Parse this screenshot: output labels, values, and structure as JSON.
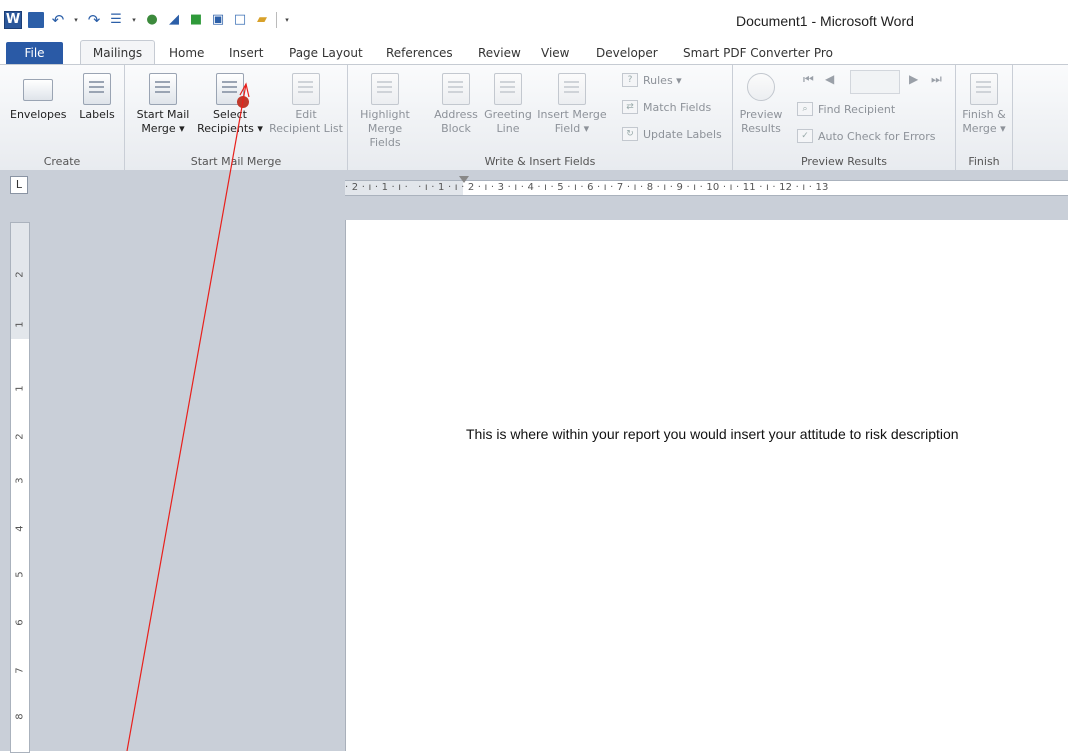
{
  "window": {
    "title": "Document1 - Microsoft Word"
  },
  "quick_access": {
    "logo_letter": "W",
    "icons": [
      "word-logo-icon",
      "save-icon",
      "undo-icon",
      "redo-icon",
      "bullets-icon",
      "people-icon",
      "send-icon",
      "book-icon",
      "print-preview-icon",
      "new-document-icon",
      "open-folder-icon",
      "customize-icon"
    ]
  },
  "tabs": [
    {
      "id": "file",
      "label": "File"
    },
    {
      "id": "mailings",
      "label": "Mailings",
      "active": true
    },
    {
      "id": "home",
      "label": "Home"
    },
    {
      "id": "insert",
      "label": "Insert"
    },
    {
      "id": "page-layout",
      "label": "Page Layout"
    },
    {
      "id": "references",
      "label": "References"
    },
    {
      "id": "review",
      "label": "Review"
    },
    {
      "id": "view",
      "label": "View"
    },
    {
      "id": "developer",
      "label": "Developer"
    },
    {
      "id": "smart-pdf",
      "label": "Smart PDF Converter Pro"
    }
  ],
  "ribbon": {
    "create": {
      "title": "Create",
      "envelopes": "Envelopes",
      "labels": "Labels"
    },
    "start_mail_merge": {
      "title": "Start Mail Merge",
      "start_l1": "Start Mail",
      "start_l2": "Merge ▾",
      "select_l1": "Select",
      "select_l2": "Recipients ▾",
      "edit_l1": "Edit",
      "edit_l2": "Recipient List"
    },
    "write_insert": {
      "title": "Write & Insert Fields",
      "highlight_l1": "Highlight",
      "highlight_l2": "Merge Fields",
      "address_l1": "Address",
      "address_l2": "Block",
      "greeting_l1": "Greeting",
      "greeting_l2": "Line",
      "insert_l1": "Insert Merge",
      "insert_l2": "Field ▾",
      "rules": "Rules ▾",
      "match": "Match Fields",
      "update": "Update Labels"
    },
    "preview": {
      "title": "Preview Results",
      "preview_l1": "Preview",
      "preview_l2": "Results",
      "find": "Find Recipient",
      "auto_check": "Auto Check for Errors"
    },
    "finish": {
      "title": "Finish",
      "finish_l1": "Finish &",
      "finish_l2": "Merge ▾"
    }
  },
  "ruler": {
    "tab_selector": "L",
    "horizontal": "· 2 · ı · 1 · ı ·   · ı · 1 · ı · 2 · ı · 3 · ı · 4 · ı · 5 · ı · 6 · ı · 7 · ı · 8 · ı · 9 · ı · 10 · ı · 11 · ı · 12 · ı · 13",
    "vertical": [
      "2",
      "1",
      "1",
      "2",
      "3",
      "4",
      "5",
      "6",
      "7",
      "8"
    ]
  },
  "document": {
    "text": "This is where within your report you would insert your attitude to risk description"
  }
}
